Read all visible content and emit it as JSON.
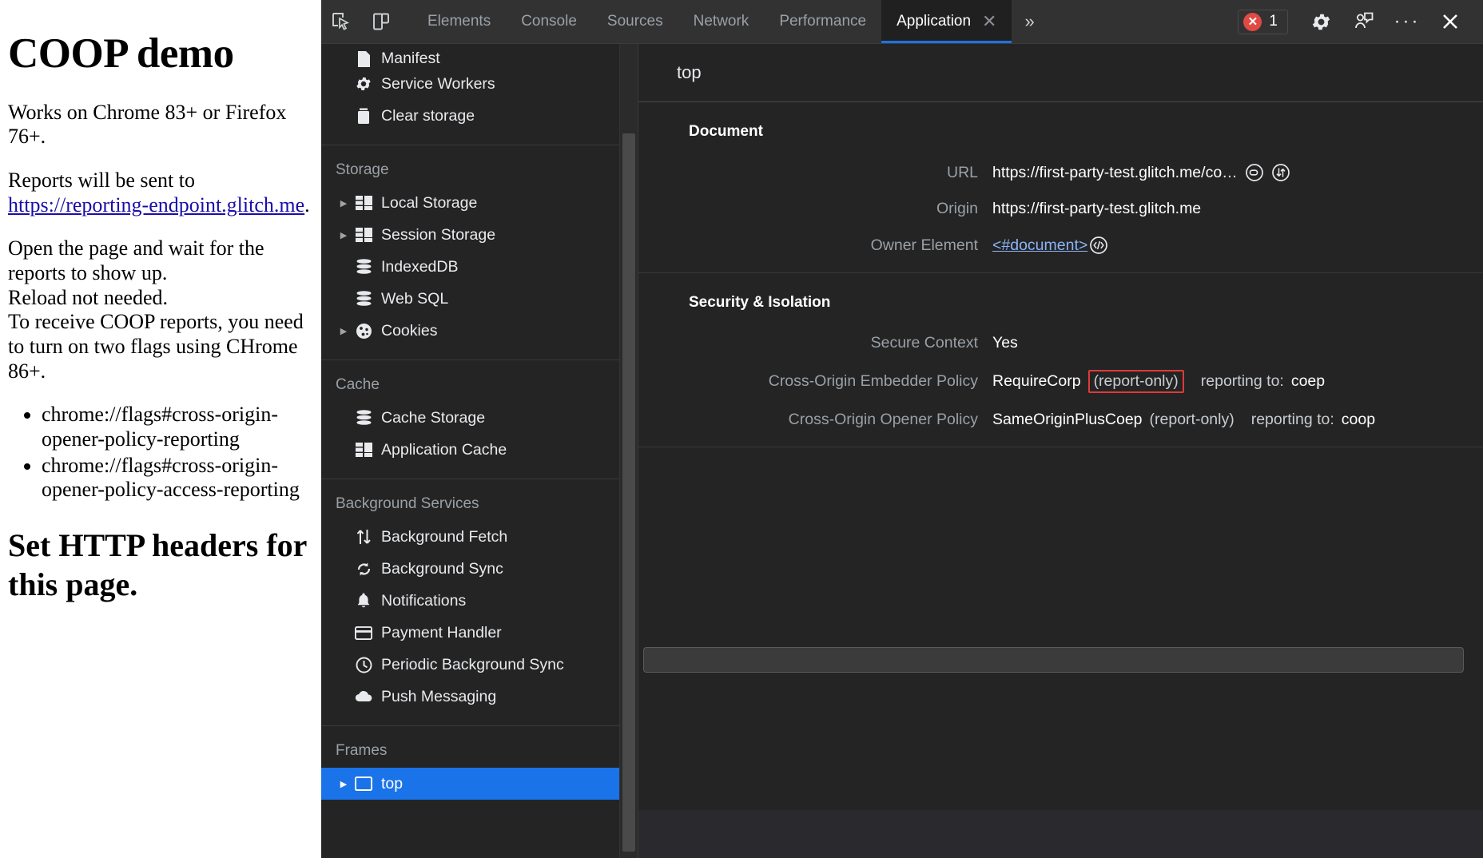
{
  "webpage": {
    "title": "COOP demo",
    "paragraph1": "Works on Chrome 83+ or Firefox 76+.",
    "paragraph2_pre": "Reports will be sent to ",
    "link_text": "https://reporting-endpoint.glitch.me",
    "paragraph2_post": ".",
    "paragraph3_line1": "Open the page and wait for the reports to show up.",
    "paragraph3_line2": "Reload not needed.",
    "paragraph3_line3": "To receive COOP reports, you need to turn on two flags using CHrome 86+.",
    "flags": [
      "chrome://flags#cross-origin-opener-policy-reporting",
      "chrome://flags#cross-origin-opener-policy-access-reporting"
    ],
    "heading2": "Set HTTP headers for this page.",
    "link_color": "#1a0dab"
  },
  "devtools": {
    "toolbar": {
      "inspect_icon": "inspect-element-icon",
      "device_icon": "device-toolbar-icon",
      "tabs": [
        {
          "label": "Elements",
          "active": false
        },
        {
          "label": "Console",
          "active": false
        },
        {
          "label": "Sources",
          "active": false
        },
        {
          "label": "Network",
          "active": false
        },
        {
          "label": "Performance",
          "active": false
        },
        {
          "label": "Application",
          "active": true
        }
      ],
      "close_tab_glyph": "✕",
      "more_tabs_glyph": "»",
      "error_count": "1",
      "settings_icon": "gear-icon",
      "feedback_icon": "feedback-icon",
      "more_options_glyph": "···",
      "close_glyph": "✕",
      "accent_color": "#1a73e8",
      "error_color": "#e04a44"
    },
    "sidebar": {
      "top_items": [
        {
          "label": "Manifest",
          "icon": "manifest-icon",
          "expandable": false
        },
        {
          "label": "Service Workers",
          "icon": "gear-icon",
          "expandable": false
        },
        {
          "label": "Clear storage",
          "icon": "trash-icon",
          "expandable": false
        }
      ],
      "groups": [
        {
          "title": "Storage",
          "items": [
            {
              "label": "Local Storage",
              "icon": "table-icon",
              "expandable": true
            },
            {
              "label": "Session Storage",
              "icon": "table-icon",
              "expandable": true
            },
            {
              "label": "IndexedDB",
              "icon": "database-icon",
              "expandable": false
            },
            {
              "label": "Web SQL",
              "icon": "database-icon",
              "expandable": false
            },
            {
              "label": "Cookies",
              "icon": "cookie-icon",
              "expandable": true
            }
          ]
        },
        {
          "title": "Cache",
          "items": [
            {
              "label": "Cache Storage",
              "icon": "database-icon",
              "expandable": false
            },
            {
              "label": "Application Cache",
              "icon": "table-icon",
              "expandable": false
            }
          ]
        },
        {
          "title": "Background Services",
          "items": [
            {
              "label": "Background Fetch",
              "icon": "transfer-icon",
              "expandable": false
            },
            {
              "label": "Background Sync",
              "icon": "sync-icon",
              "expandable": false
            },
            {
              "label": "Notifications",
              "icon": "bell-icon",
              "expandable": false
            },
            {
              "label": "Payment Handler",
              "icon": "credit-card-icon",
              "expandable": false
            },
            {
              "label": "Periodic Background Sync",
              "icon": "clock-icon",
              "expandable": false
            },
            {
              "label": "Push Messaging",
              "icon": "cloud-icon",
              "expandable": false
            }
          ]
        },
        {
          "title": "Frames",
          "items": [
            {
              "label": "top",
              "icon": "frame-icon",
              "expandable": true,
              "selected": true
            }
          ]
        }
      ],
      "selected_color": "#1a73e8"
    },
    "main": {
      "header_title": "top",
      "sections": [
        {
          "title": "Document",
          "rows": [
            {
              "label": "URL",
              "value": "https://first-party-test.glitch.me/co…",
              "icons": [
                "open-in-new-tab-icon",
                "reveal-in-network-icon"
              ]
            },
            {
              "label": "Origin",
              "value": "https://first-party-test.glitch.me",
              "icons": []
            },
            {
              "label": "Owner Element",
              "value": "<#document>",
              "link": true,
              "icons": [
                "code-icon"
              ]
            }
          ]
        },
        {
          "title": "Security & Isolation",
          "rows": [
            {
              "label": "Secure Context",
              "value": "Yes",
              "icons": []
            },
            {
              "label": "Cross-Origin Embedder Policy",
              "value": "RequireCorp",
              "badge": "(report-only)",
              "badge_highlight": true,
              "extra_label": "reporting to:",
              "extra_value": "coep",
              "icons": []
            },
            {
              "label": "Cross-Origin Opener Policy",
              "value": "SameOriginPlusCoep",
              "badge": "(report-only)",
              "badge_highlight": false,
              "extra_label": "reporting to:",
              "extra_value": "coop",
              "icons": []
            }
          ]
        }
      ],
      "highlight_color": "#e03a3a",
      "link_color": "#8ab4f8"
    }
  }
}
